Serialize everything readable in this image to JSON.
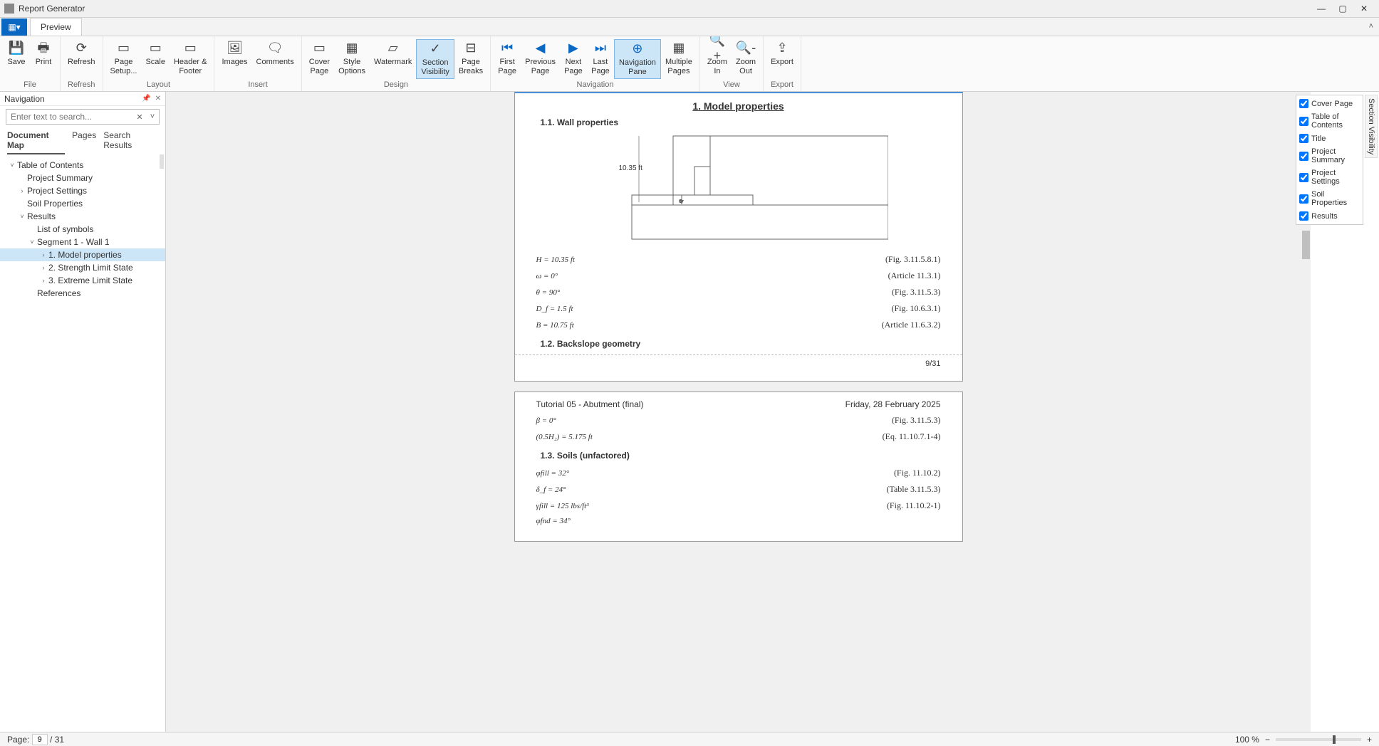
{
  "window": {
    "title": "Report Generator"
  },
  "tabs": {
    "preview": "Preview"
  },
  "ribbon": {
    "file": {
      "save": "Save",
      "print": "Print",
      "group": "File"
    },
    "refresh": {
      "refresh": "Refresh",
      "group": "Refresh"
    },
    "layout": {
      "pagesetup": "Page\nSetup...",
      "scale": "Scale",
      "headerfooter": "Header &\nFooter",
      "group": "Layout"
    },
    "insert": {
      "images": "Images",
      "comments": "Comments",
      "group": "Insert"
    },
    "design": {
      "coverpage": "Cover\nPage",
      "styleoptions": "Style\nOptions",
      "watermark": "Watermark",
      "sectionvis": "Section\nVisibility",
      "pagebreaks": "Page\nBreaks",
      "group": "Design"
    },
    "navigation": {
      "first": "First\nPage",
      "prev": "Previous\nPage",
      "next": "Next\nPage",
      "last": "Last\nPage",
      "navpane": "Navigation\nPane",
      "multi": "Multiple\nPages",
      "group": "Navigation"
    },
    "view": {
      "zoomin": "Zoom\nIn",
      "zoomout": "Zoom\nOut",
      "group": "View"
    },
    "export": {
      "export": "Export",
      "group": "Export"
    }
  },
  "nav": {
    "title": "Navigation",
    "search_placeholder": "Enter text to search...",
    "tabs": {
      "docmap": "Document Map",
      "pages": "Pages",
      "results": "Search Results"
    },
    "tree": {
      "toc": "Table of Contents",
      "projsum": "Project Summary",
      "projset": "Project Settings",
      "soil": "Soil Properties",
      "results": "Results",
      "los": "List of symbols",
      "seg": "Segment 1 - Wall 1",
      "mp": "1.  Model properties",
      "sls": "2.  Strength Limit State",
      "els": "3.  Extreme Limit State",
      "refs": "References"
    }
  },
  "doc": {
    "h1": "1.  Model properties",
    "h11": "1.1.  Wall properties",
    "dim": "10.35 ft",
    "o": "o",
    "eqs1": [
      {
        "l": "H = 10.35 ft",
        "r": "(Fig. 3.11.5.8.1)"
      },
      {
        "l": "ω = 0°",
        "r": "(Article 11.3.1)"
      },
      {
        "l": "θ = 90°",
        "r": "(Fig. 3.11.5.3)"
      },
      {
        "l": "D_f = 1.5 ft",
        "r": "(Fig. 10.6.3.1)"
      },
      {
        "l": "B = 10.75 ft",
        "r": "(Article 11.6.3.2)"
      }
    ],
    "h12": "1.2.  Backslope geometry",
    "pgnum1": "9/31",
    "hdr_l": "Tutorial 05 - Abutment (final)",
    "hdr_r": "Friday, 28 February 2025",
    "eqs2": [
      {
        "l": "β = 0°",
        "r": "(Fig. 3.11.5.3)"
      },
      {
        "l": "(0.5H₂) = 5.175 ft",
        "r": "(Eq. 11.10.7.1-4)"
      }
    ],
    "h13": "1.3.  Soils (unfactored)",
    "eqs3": [
      {
        "l": "φfill = 32°",
        "r": "(Fig. 11.10.2)"
      },
      {
        "l": "δ_f = 24°",
        "r": "(Table 3.11.5.3)"
      },
      {
        "l": "γfill = 125 lbs/ft³",
        "r": "(Fig. 11.10.2-1)"
      },
      {
        "l": "φfnd = 34°",
        "r": ""
      }
    ]
  },
  "vis": {
    "title": "Section Visibility",
    "items": [
      "Cover Page",
      "Table of Contents",
      "Title",
      "Project Summary",
      "Project Settings",
      "Soil Properties",
      "Results"
    ]
  },
  "status": {
    "page_label": "Page:",
    "page_cur": "9",
    "page_sep": "/ 31",
    "zoom": "100 %"
  }
}
